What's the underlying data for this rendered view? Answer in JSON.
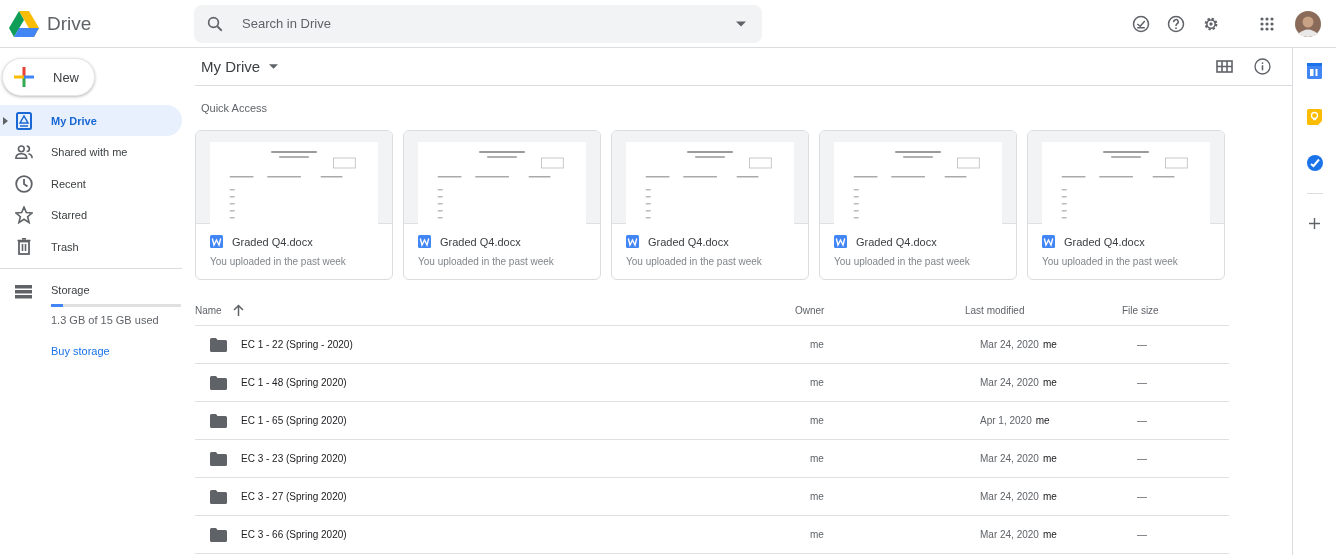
{
  "header": {
    "app_name": "Drive",
    "search": {
      "placeholder": "Search in Drive"
    }
  },
  "sidebar": {
    "new_button": "New",
    "items": [
      {
        "label": "My Drive",
        "selected": true,
        "expandable": true
      },
      {
        "label": "Shared with me",
        "selected": false,
        "expandable": false
      },
      {
        "label": "Recent",
        "selected": false,
        "expandable": false
      },
      {
        "label": "Starred",
        "selected": false,
        "expandable": false
      },
      {
        "label": "Trash",
        "selected": false,
        "expandable": false
      }
    ],
    "storage": {
      "label": "Storage",
      "level": 0.09,
      "usage": "1.3 GB of 15 GB used",
      "link": "Buy storage"
    }
  },
  "toolbar": {
    "title": "My Drive"
  },
  "quick_access": {
    "title": "Quick Access",
    "cards": [
      {
        "name": "Graded Q4.docx",
        "reason": "You uploaded in the past week"
      },
      {
        "name": "Graded Q4.docx",
        "reason": "You uploaded in the past week"
      },
      {
        "name": "Graded Q4.docx",
        "reason": "You uploaded in the past week"
      },
      {
        "name": "Graded Q4.docx",
        "reason": "You uploaded in the past week"
      },
      {
        "name": "Graded Q4.docx",
        "reason": "You uploaded in the past week"
      }
    ]
  },
  "table": {
    "columns": [
      "Name",
      "Owner",
      "Last modified",
      "File size"
    ],
    "rows": [
      {
        "name": "EC 1 - 22 (Spring - 2020)",
        "owner": "me",
        "modified": "Mar 24, 2020",
        "modified_by": "me",
        "size": "—"
      },
      {
        "name": "EC 1 - 48 (Spring 2020)",
        "owner": "me",
        "modified": "Mar 24, 2020",
        "modified_by": "me",
        "size": "—"
      },
      {
        "name": "EC 1 - 65 (Spring 2020)",
        "owner": "me",
        "modified": "Apr 1, 2020",
        "modified_by": "me",
        "size": "—"
      },
      {
        "name": "EC 3 - 23 (Spring 2020)",
        "owner": "me",
        "modified": "Mar 24, 2020",
        "modified_by": "me",
        "size": "—"
      },
      {
        "name": "EC 3 - 27 (Spring 2020)",
        "owner": "me",
        "modified": "Mar 24, 2020",
        "modified_by": "me",
        "size": "—"
      },
      {
        "name": "EC 3 - 66 (Spring 2020)",
        "owner": "me",
        "modified": "Mar 24, 2020",
        "modified_by": "me",
        "size": "—"
      }
    ]
  }
}
